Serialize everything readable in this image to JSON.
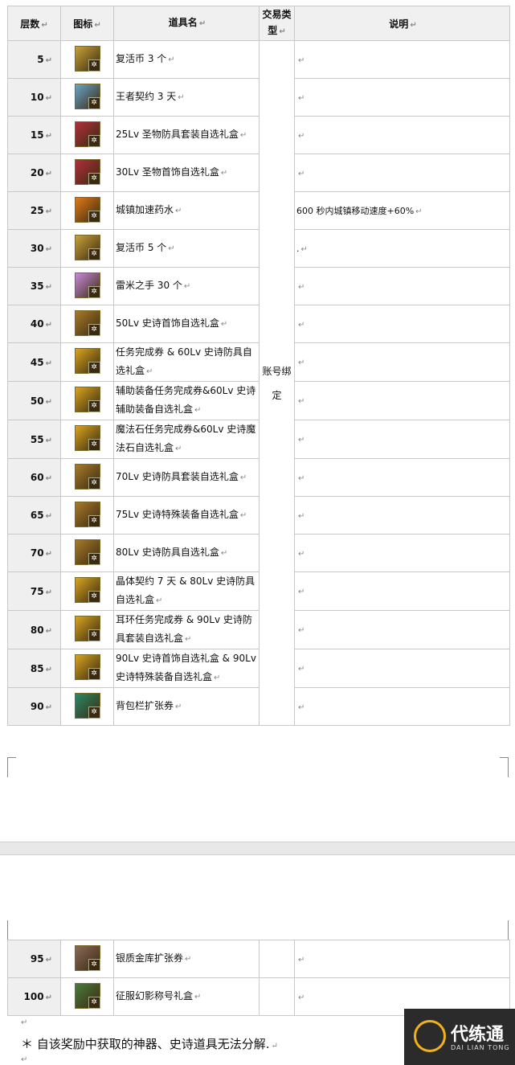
{
  "headers": {
    "layer": "层数",
    "icon": "图标",
    "name": "道具名",
    "trade": "交易类型",
    "desc": "说明"
  },
  "trade_type": "账号绑定",
  "rows": [
    {
      "layer": "5",
      "name": "复活币 3 个",
      "desc": "",
      "icon": "revival-coin-icon",
      "color": "#c9a23a"
    },
    {
      "layer": "10",
      "name": "王者契约 3 天",
      "desc": "",
      "icon": "contract-icon",
      "color": "#6aa4c8"
    },
    {
      "layer": "15",
      "name": "25Lv 圣物防具套装自选礼盒",
      "desc": "",
      "icon": "gift-box-icon",
      "color": "#b0303a"
    },
    {
      "layer": "20",
      "name": "30Lv 圣物首饰自选礼盒",
      "desc": "",
      "icon": "gift-box-icon",
      "color": "#b0303a"
    },
    {
      "layer": "25",
      "name": "城镇加速药水",
      "desc": "600 秒内城镇移动速度+60%",
      "icon": "potion-icon",
      "color": "#e07a18"
    },
    {
      "layer": "30",
      "name": "复活币 5 个",
      "desc": ".",
      "icon": "revival-coin-icon",
      "color": "#c9a23a"
    },
    {
      "layer": "35",
      "name": "雷米之手 30 个",
      "desc": "",
      "icon": "hand-icon",
      "color": "#c98ad8"
    },
    {
      "layer": "40",
      "name": "50Lv 史诗首饰自选礼盒",
      "desc": "",
      "icon": "epic-chest-icon",
      "color": "#a87a2a"
    },
    {
      "layer": "45",
      "name": "任务完成券 & 60Lv 史诗防具自选礼盒",
      "desc": "",
      "icon": "ticket-icon",
      "color": "#d8a420"
    },
    {
      "layer": "50",
      "name": "辅助装备任务完成券&60Lv 史诗辅助装备自选礼盒",
      "desc": "",
      "icon": "ticket-icon",
      "color": "#d8a420"
    },
    {
      "layer": "55",
      "name": "魔法石任务完成券&60Lv 史诗魔法石自选礼盒",
      "desc": "",
      "icon": "ticket-icon",
      "color": "#d8a420"
    },
    {
      "layer": "60",
      "name": "70Lv 史诗防具套装自选礼盒",
      "desc": "",
      "icon": "epic-chest-icon",
      "color": "#a87a2a"
    },
    {
      "layer": "65",
      "name": "75Lv 史诗特殊装备自选礼盒",
      "desc": "",
      "icon": "epic-chest-icon",
      "color": "#a87a2a"
    },
    {
      "layer": "70",
      "name": "80Lv 史诗防具自选礼盒",
      "desc": "",
      "icon": "epic-chest-icon",
      "color": "#a87a2a"
    },
    {
      "layer": "75",
      "name": "晶体契约 7 天 & 80Lv 史诗防具自选礼盒",
      "desc": "",
      "icon": "ticket-icon",
      "color": "#d8a420"
    },
    {
      "layer": "80",
      "name": "耳环任务完成券 & 90Lv 史诗防具套装自选礼盒",
      "desc": "",
      "icon": "ticket-icon",
      "color": "#d8a420"
    },
    {
      "layer": "85",
      "name": "90Lv 史诗首饰自选礼盒 & 90Lv 史诗特殊装备自选礼盒",
      "desc": "",
      "icon": "ticket-icon",
      "color": "#d8a420"
    },
    {
      "layer": "90",
      "name": "背包栏扩张券",
      "desc": "",
      "icon": "bag-expand-icon",
      "color": "#2a8a6a"
    }
  ],
  "rows2": [
    {
      "layer": "95",
      "name": "银质金库扩张券",
      "desc": "",
      "icon": "vault-icon",
      "color": "#8a6a5a"
    },
    {
      "layer": "100",
      "name": "征服幻影称号礼盒",
      "desc": "",
      "icon": "title-box-icon",
      "color": "#4a7a3a"
    }
  ],
  "note": "＊ 自该奖励中获取的神器、史诗道具无法分解.",
  "watermark": {
    "title": "代练通",
    "subtitle": "DAI LIAN TONG"
  }
}
